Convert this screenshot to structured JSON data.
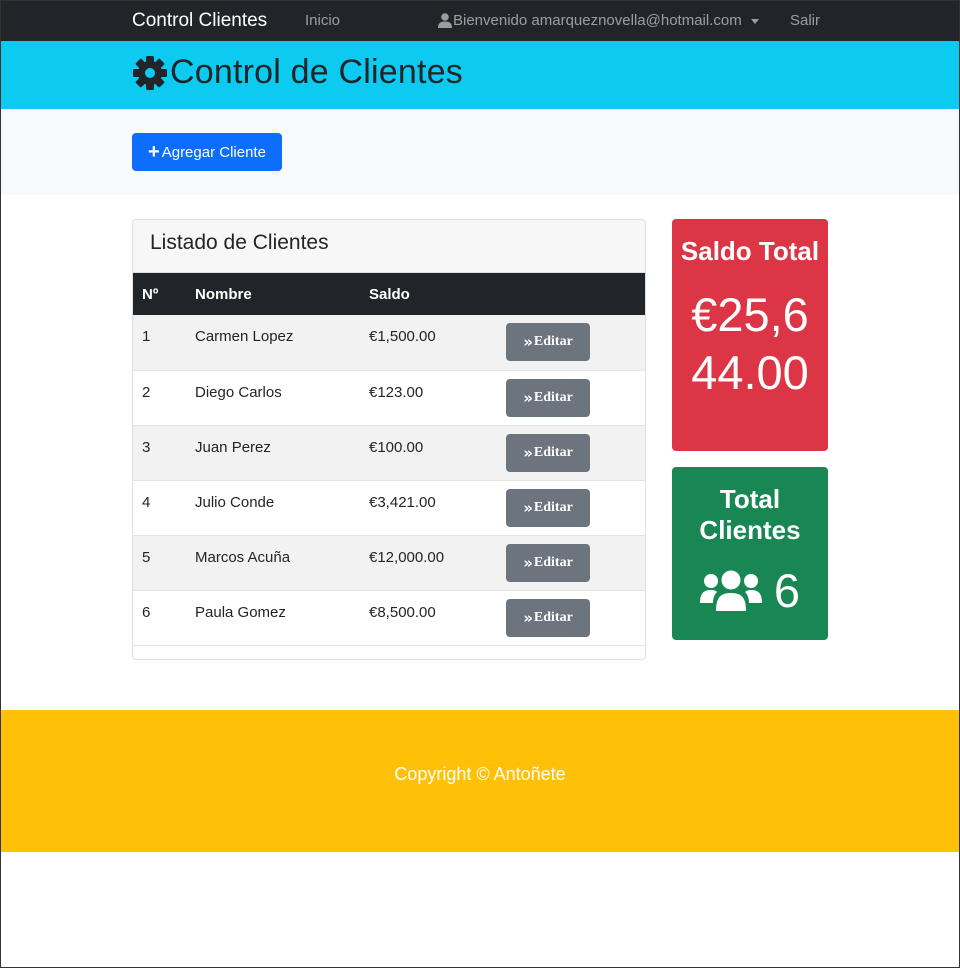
{
  "navbar": {
    "brand": "Control Clientes",
    "inicio": "Inicio",
    "user": "Bienvenido amarqueznovella@hotmail.com",
    "salir": "Salir"
  },
  "header": {
    "title": "Control de Clientes"
  },
  "actions": {
    "add_label": "Agregar Cliente"
  },
  "list": {
    "title": "Listado de Clientes",
    "columns": [
      "Nº",
      "Nombre",
      "Saldo",
      ""
    ],
    "edit_label": "Editar",
    "rows": [
      {
        "n": "1",
        "nombre": "Carmen Lopez",
        "saldo": "€1,500.00"
      },
      {
        "n": "2",
        "nombre": "Diego Carlos",
        "saldo": "€123.00"
      },
      {
        "n": "3",
        "nombre": "Juan Perez",
        "saldo": "€100.00"
      },
      {
        "n": "4",
        "nombre": "Julio Conde",
        "saldo": "€3,421.00"
      },
      {
        "n": "5",
        "nombre": "Marcos Acuña",
        "saldo": "€12,000.00"
      },
      {
        "n": "6",
        "nombre": "Paula Gomez",
        "saldo": "€8,500.00"
      }
    ]
  },
  "saldo_total": {
    "title": "Saldo Total",
    "value": "€25,644.00"
  },
  "total_clientes": {
    "title": "Total Clientes",
    "value": "6"
  },
  "footer": {
    "text": "Copyright © Antoñete"
  },
  "colors": {
    "navbar": "#212529",
    "header": "#0dcaf0",
    "primary": "#0d6efd",
    "secondary": "#6c757d",
    "danger": "#dc3545",
    "success": "#198754",
    "warning": "#ffc107"
  }
}
